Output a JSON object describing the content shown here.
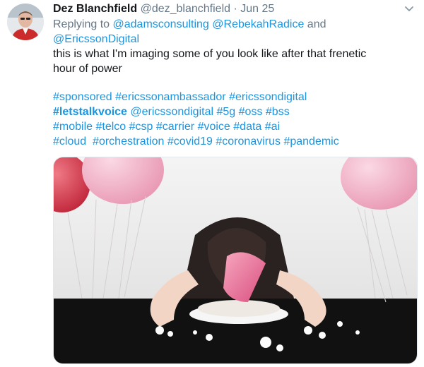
{
  "tweet": {
    "author_name": "Dez Blanchfield",
    "author_handle": "@dez_blanchfield",
    "separator": "·",
    "timestamp": "Jun 25",
    "reply": {
      "prefix": "Replying to ",
      "user1": "@adamsconsulting",
      "user2": "@RebekahRadice",
      "and_word": " and ",
      "user3": "@EricssonDigital"
    },
    "text_line1": "this is what I'm imaging some of you look like after that frenetic",
    "text_line2": "hour of power",
    "hashtags": {
      "line1": [
        "#sponsored",
        "#ericssonambassador",
        "#ericssondigital"
      ],
      "line2_bold": "#letstalkvoice",
      "line2": [
        "@ericssondigital",
        "#5g",
        "#oss",
        "#bss"
      ],
      "line3": [
        "#mobile",
        "#telco",
        "#csp",
        "#carrier",
        "#voice",
        "#data",
        "#ai"
      ],
      "line4": [
        "#cloud",
        "#orchestration",
        "#covid19",
        "#coronavirus",
        "#pandemic"
      ]
    }
  },
  "icons": {
    "more": "chevron-down-icon",
    "avatar": "avatar-photo",
    "media": "party-photo"
  },
  "colors": {
    "link": "#1b95e0",
    "secondary": "#657786",
    "text": "#14171a",
    "balloon_pink": "#f3b6c8",
    "hat_pink": "#e86a92"
  }
}
